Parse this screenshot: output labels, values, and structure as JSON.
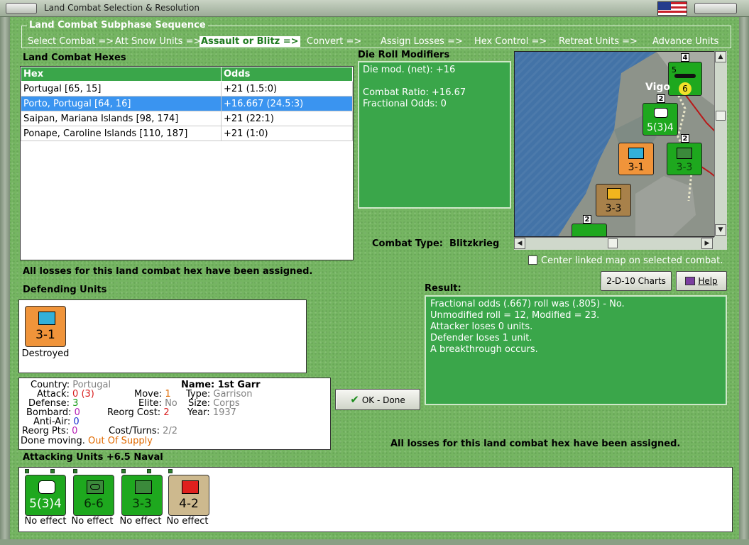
{
  "window": {
    "title": "Land Combat Selection & Resolution"
  },
  "subphase": {
    "title": "Land Combat Subphase Sequence",
    "steps": [
      "Select Combat =>",
      "Att Snow Units =>",
      "Assault or Blitz =>",
      "Convert =>",
      "Assign Losses =>",
      "Hex Control =>",
      "Retreat Units =>",
      "Advance Units"
    ],
    "active_index": 2
  },
  "hexes": {
    "title": "Land Combat Hexes",
    "columns": [
      "Hex",
      "Odds"
    ],
    "rows": [
      {
        "hex": "Portugal [65, 15]",
        "odds": "+21 (1.5:0)"
      },
      {
        "hex": "Porto, Portugal [64, 16]",
        "odds": "+16.667 (24.5:3)"
      },
      {
        "hex": "Saipan, Mariana Islands [98, 174]",
        "odds": "+21 (22:1)"
      },
      {
        "hex": "Ponape, Caroline Islands [110, 187]",
        "odds": "+21 (1:0)"
      }
    ],
    "selected_index": 1
  },
  "die_roll": {
    "title": "Die Roll Modifiers",
    "lines": [
      "Die mod. (net): +16",
      "",
      "Combat Ratio: +16.67",
      "Fractional Odds: 0"
    ]
  },
  "combat_type": {
    "label": "Combat Type:",
    "value": "Blitzkrieg"
  },
  "map": {
    "place_label": "Vigo",
    "counters": [
      {
        "id": "naval",
        "stack": "5",
        "value": "6"
      },
      {
        "id": "mot",
        "stack": "2",
        "str": "5(3)4"
      },
      {
        "id": "defender",
        "str": "3-1"
      },
      {
        "id": "inf",
        "stack": "2",
        "str": "3-3"
      },
      {
        "id": "fortress",
        "str": "3-3"
      },
      {
        "id": "bottom",
        "stack": "2",
        "str": ""
      }
    ],
    "top_stack": "4"
  },
  "center_map_label": "Center linked map on selected combat.",
  "losses_note": "All losses for this land combat hex have been assigned.",
  "buttons": {
    "charts": "2-D-10 Charts",
    "help": "Help",
    "ok": "OK - Done"
  },
  "result": {
    "title": "Result:",
    "lines": [
      "Fractional odds (.667) roll was (.805)  - No.",
      "Unmodified roll = 12, Modified = 23.",
      "Attacker loses 0 units.",
      "Defender loses 1 unit.",
      "A breakthrough occurs."
    ]
  },
  "defending": {
    "title": "Defending Units",
    "units": [
      {
        "str": "3-1",
        "caption": "Destroyed"
      }
    ]
  },
  "unit_info": {
    "country_label": "Country:",
    "country": "Portugal",
    "attack_label": "Attack:",
    "attack": "0",
    "attack_mod": "(3)",
    "defense_label": "Defense:",
    "defense": "3",
    "bombard_label": "Bombard:",
    "bombard": "0",
    "antiair_label": "Anti-Air:",
    "antiair": "0",
    "reorgpts_label": "Reorg Pts:",
    "reorgpts": "0",
    "move_label": "Move:",
    "move": "1",
    "elite_label": "Elite:",
    "elite": "No",
    "reorgcost_label": "Reorg Cost:",
    "reorgcost": "2",
    "costturns_label": "Cost/Turns:",
    "costturns": "2/2",
    "name_label": "Name:",
    "name": "1st Garr",
    "type_label": "Type:",
    "type": "Garrison",
    "size_label": "Size:",
    "size": "Corps",
    "year_label": "Year:",
    "year": "1937",
    "done_label": "Done moving.",
    "supply": "Out Of Supply"
  },
  "attacking": {
    "title": "Attacking Units +6.5 Naval",
    "units": [
      {
        "str": "5(3)4",
        "caption": "No effect",
        "kind": "mot"
      },
      {
        "str": "6-6",
        "caption": "No effect",
        "kind": "arm"
      },
      {
        "str": "3-3",
        "caption": "No effect",
        "kind": "mtn"
      },
      {
        "str": "4-2",
        "caption": "No effect",
        "kind": "tank-red"
      }
    ]
  },
  "colors": {
    "accent_green": "#3aa64a",
    "selection_blue": "#3a94f0",
    "grass": "#75b562"
  }
}
